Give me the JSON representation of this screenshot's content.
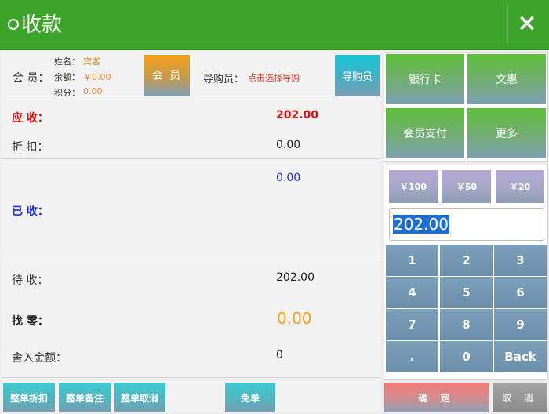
{
  "header": {
    "title": "收款",
    "close_icon": "×"
  },
  "member": {
    "label": "会 员：",
    "name_label": "姓名：",
    "name_value": "宾客",
    "balance_label": "余额：",
    "balance_value": "￥0.00",
    "points_label": "积分：",
    "points_value": "0.00",
    "member_button": "会 员",
    "guide_label": "导购员：",
    "guide_value": "点击选择导购",
    "guide_button": "导购员"
  },
  "summary": {
    "receivable_label": "应 收：",
    "receivable_value": "202.00",
    "discount_label": "折 扣：",
    "discount_value": "0.00",
    "received_label": "已 收：",
    "received_value": "0.00",
    "pending_label": "待 收：",
    "pending_value": "202.00",
    "change_label": "找 零：",
    "change_value": "0.00",
    "rounding_label": "舍入金额：",
    "rounding_value": "0"
  },
  "bottom_buttons": {
    "order_discount": "整单折扣",
    "order_note": "整单备注",
    "order_cancel": "整单取消",
    "free_order": "免单"
  },
  "payment_methods": {
    "bank_card": "银行卡",
    "wenhui": "文惠",
    "member_pay": "会员支付",
    "more": "更多"
  },
  "quick_amounts": {
    "a100": "￥100",
    "a50": "￥50",
    "a20": "￥20"
  },
  "amount_input": "202.00",
  "keypad": {
    "k1": "1",
    "k2": "2",
    "k3": "3",
    "k4": "4",
    "k5": "5",
    "k6": "6",
    "k7": "7",
    "k8": "8",
    "k9": "9",
    "kdot": ".",
    "k0": "0",
    "kback": "Back"
  },
  "actions": {
    "confirm": "确 定",
    "cancel": "取 消"
  },
  "colors": {
    "header": "#3aa529",
    "receivable": "#e01010",
    "received": "#1a2fd6",
    "change": "#f5a015"
  }
}
